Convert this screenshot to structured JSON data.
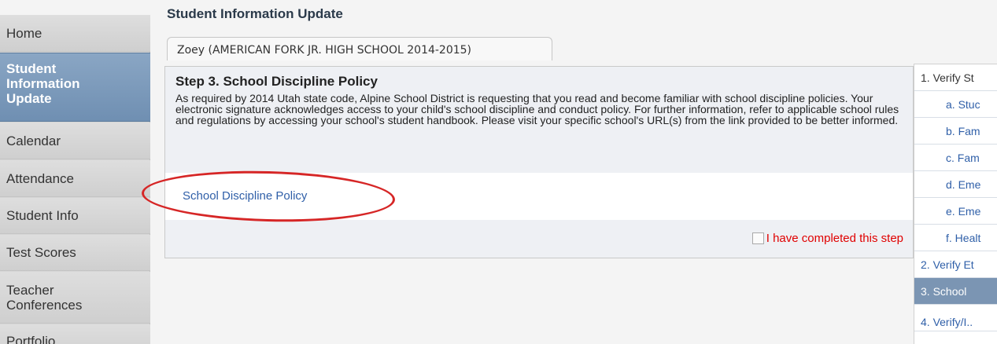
{
  "page_title": "Student Information Update",
  "nav": {
    "items": [
      {
        "label": "Home"
      },
      {
        "label": "Student\nInformation\nUpdate"
      },
      {
        "label": "Calendar"
      },
      {
        "label": "Attendance"
      },
      {
        "label": "Student Info"
      },
      {
        "label": "Test Scores"
      },
      {
        "label": "Teacher\nConferences"
      },
      {
        "label": "Portfolio"
      }
    ],
    "active_index": 1
  },
  "tab": {
    "label": "Zoey (AMERICAN FORK JR. HIGH SCHOOL 2014-2015)"
  },
  "step": {
    "title": "Step 3. School Discipline Policy",
    "description": "As required by 2014 Utah state code, Alpine School District is requesting that you read and become familiar with school discipline policies. Your electronic signature acknowledges access to your child's school discipline and conduct policy. For further information, refer to applicable school rules and regulations by accessing your school's student handbook. Please visit your specific school's URL(s) from the link provided to be better informed.",
    "link_label": "School Discipline Policy",
    "completed_label": "I have completed this step",
    "completed": false
  },
  "steps_list": [
    {
      "label": "1. Verify St"
    },
    {
      "label": "a. Stuc"
    },
    {
      "label": "b. Fam"
    },
    {
      "label": "c. Fam"
    },
    {
      "label": "d. Eme"
    },
    {
      "label": "e. Eme"
    },
    {
      "label": "f. Healt"
    },
    {
      "label": "2. Verify Et"
    },
    {
      "label": "3. School"
    },
    {
      "label": "4. Verify/I.."
    }
  ],
  "colors": {
    "accent": "#7b95b3",
    "link": "#2f5fa8",
    "alert": "#e00000",
    "highlight_oval": "#d62626"
  }
}
